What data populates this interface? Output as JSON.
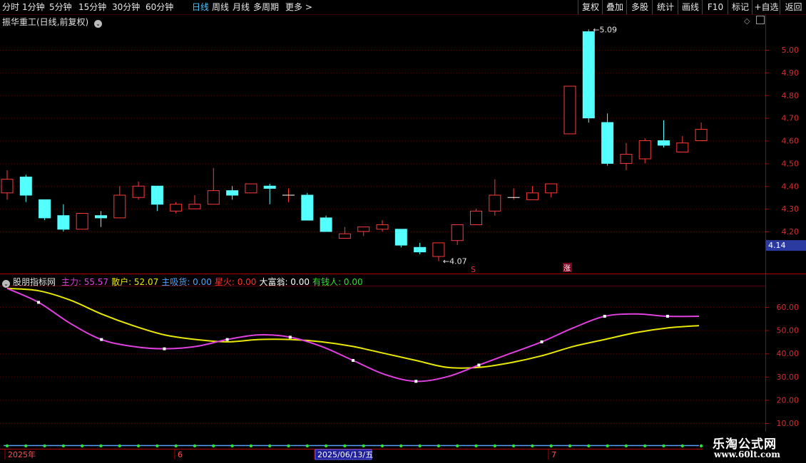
{
  "toolbar": {
    "periods": [
      "分时",
      "1分钟",
      "5分钟",
      "15分钟",
      "30分钟",
      "60分钟",
      "日线",
      "周线",
      "月线",
      "多周期",
      "更多"
    ],
    "active_period": "日线",
    "right_buttons": [
      "复权",
      "叠加",
      "多股",
      "统计",
      "画线",
      "F10",
      "标记",
      "+自选",
      "返回"
    ]
  },
  "chart_title": "振华重工(日线,前复权)",
  "price_axis": {
    "labels": [
      "5.00",
      "4.90",
      "4.80",
      "4.70",
      "4.60",
      "4.50",
      "4.40",
      "4.30",
      "4.20"
    ],
    "current_price": "4.14"
  },
  "annotations": {
    "high": "5.09",
    "low": "4.07",
    "marker_s": "S",
    "marker_zhang": "涨"
  },
  "indicator": {
    "name": "股朋指标网",
    "fields": [
      {
        "label": "主力:",
        "value": "55.57",
        "color": "#e040e0"
      },
      {
        "label": "散户:",
        "value": "52.07",
        "color": "#e8e800"
      },
      {
        "label": "主吸货:",
        "value": "0.00",
        "color": "#4fa3ff"
      },
      {
        "label": "星火:",
        "value": "0.00",
        "color": "#ff3030"
      },
      {
        "label": "大富翁:",
        "value": "0.00",
        "color": "#ffffff"
      },
      {
        "label": "有钱人:",
        "value": "0.00",
        "color": "#30e030"
      }
    ],
    "axis_labels": [
      "60.00",
      "50.00",
      "40.00",
      "30.00",
      "20.00",
      "10.00"
    ]
  },
  "date_axis": {
    "labels": [
      "2025年",
      "6",
      "2025/06/13/五",
      "7"
    ]
  },
  "logo": {
    "line1": "乐淘公式网",
    "line2": "www.60lt.com"
  },
  "chart_data": {
    "type": "candlestick",
    "title": "振华重工(日线,前复权)",
    "ylim": [
      4.07,
      5.09
    ],
    "candles": [
      {
        "o": 4.37,
        "c": 4.43,
        "h": 4.47,
        "l": 4.34
      },
      {
        "o": 4.44,
        "c": 4.36,
        "h": 4.45,
        "l": 4.33
      },
      {
        "o": 4.34,
        "c": 4.26,
        "h": 4.34,
        "l": 4.25
      },
      {
        "o": 4.27,
        "c": 4.21,
        "h": 4.32,
        "l": 4.2
      },
      {
        "o": 4.21,
        "c": 4.28,
        "h": 4.28,
        "l": 4.21
      },
      {
        "o": 4.27,
        "c": 4.26,
        "h": 4.29,
        "l": 4.22
      },
      {
        "o": 4.26,
        "c": 4.36,
        "h": 4.4,
        "l": 4.26
      },
      {
        "o": 4.35,
        "c": 4.4,
        "h": 4.42,
        "l": 4.34
      },
      {
        "o": 4.4,
        "c": 4.32,
        "h": 4.4,
        "l": 4.29
      },
      {
        "o": 4.29,
        "c": 4.32,
        "h": 4.33,
        "l": 4.28
      },
      {
        "o": 4.3,
        "c": 4.32,
        "h": 4.36,
        "l": 4.3
      },
      {
        "o": 4.32,
        "c": 4.38,
        "h": 4.48,
        "l": 4.32
      },
      {
        "o": 4.38,
        "c": 4.36,
        "h": 4.4,
        "l": 4.34
      },
      {
        "o": 4.37,
        "c": 4.41,
        "h": 4.41,
        "l": 4.37
      },
      {
        "o": 4.4,
        "c": 4.39,
        "h": 4.41,
        "l": 4.32
      },
      {
        "o": 4.36,
        "c": 4.36,
        "h": 4.39,
        "l": 4.33
      },
      {
        "o": 4.36,
        "c": 4.25,
        "h": 4.37,
        "l": 4.25
      },
      {
        "o": 4.26,
        "c": 4.2,
        "h": 4.27,
        "l": 4.2
      },
      {
        "o": 4.17,
        "c": 4.19,
        "h": 4.22,
        "l": 4.17
      },
      {
        "o": 4.2,
        "c": 4.22,
        "h": 4.22,
        "l": 4.18
      },
      {
        "o": 4.21,
        "c": 4.23,
        "h": 4.25,
        "l": 4.2
      },
      {
        "o": 4.21,
        "c": 4.14,
        "h": 4.21,
        "l": 4.13
      },
      {
        "o": 4.13,
        "c": 4.11,
        "h": 4.15,
        "l": 4.1
      },
      {
        "o": 4.09,
        "c": 4.15,
        "h": 4.15,
        "l": 4.07
      },
      {
        "o": 4.16,
        "c": 4.23,
        "h": 4.23,
        "l": 4.14
      },
      {
        "o": 4.23,
        "c": 4.29,
        "h": 4.3,
        "l": 4.23
      },
      {
        "o": 4.29,
        "c": 4.36,
        "h": 4.43,
        "l": 4.27
      },
      {
        "o": 4.35,
        "c": 4.35,
        "h": 4.39,
        "l": 4.34
      },
      {
        "o": 4.34,
        "c": 4.37,
        "h": 4.4,
        "l": 4.34
      },
      {
        "o": 4.37,
        "c": 4.41,
        "h": 4.41,
        "l": 4.35
      },
      {
        "o": 4.63,
        "c": 4.84,
        "h": 4.84,
        "l": 4.63
      },
      {
        "o": 5.08,
        "c": 4.7,
        "h": 5.09,
        "l": 4.68
      },
      {
        "o": 4.68,
        "c": 4.5,
        "h": 4.72,
        "l": 4.49
      },
      {
        "o": 4.5,
        "c": 4.54,
        "h": 4.59,
        "l": 4.47
      },
      {
        "o": 4.52,
        "c": 4.6,
        "h": 4.61,
        "l": 4.5
      },
      {
        "o": 4.6,
        "c": 4.58,
        "h": 4.69,
        "l": 4.57
      },
      {
        "o": 4.55,
        "c": 4.59,
        "h": 4.62,
        "l": 4.55
      },
      {
        "o": 4.6,
        "c": 4.65,
        "h": 4.68,
        "l": 4.6
      }
    ],
    "indicator_series": [
      {
        "name": "主力",
        "color": "#e040e0",
        "values": [
          68,
          62,
          53,
          46,
          43,
          42,
          43,
          46,
          48,
          47,
          43,
          37,
          31,
          28,
          30,
          35,
          40,
          45,
          51,
          56,
          57,
          56,
          56
        ]
      },
      {
        "name": "散户",
        "color": "#e8e800",
        "values": [
          68,
          67,
          63,
          57,
          52,
          48,
          46,
          45,
          46,
          46,
          45,
          43,
          40,
          37,
          34,
          34,
          36,
          39,
          43,
          46,
          49,
          51,
          52
        ]
      }
    ],
    "indicator_ylim": [
      10,
      70
    ]
  }
}
